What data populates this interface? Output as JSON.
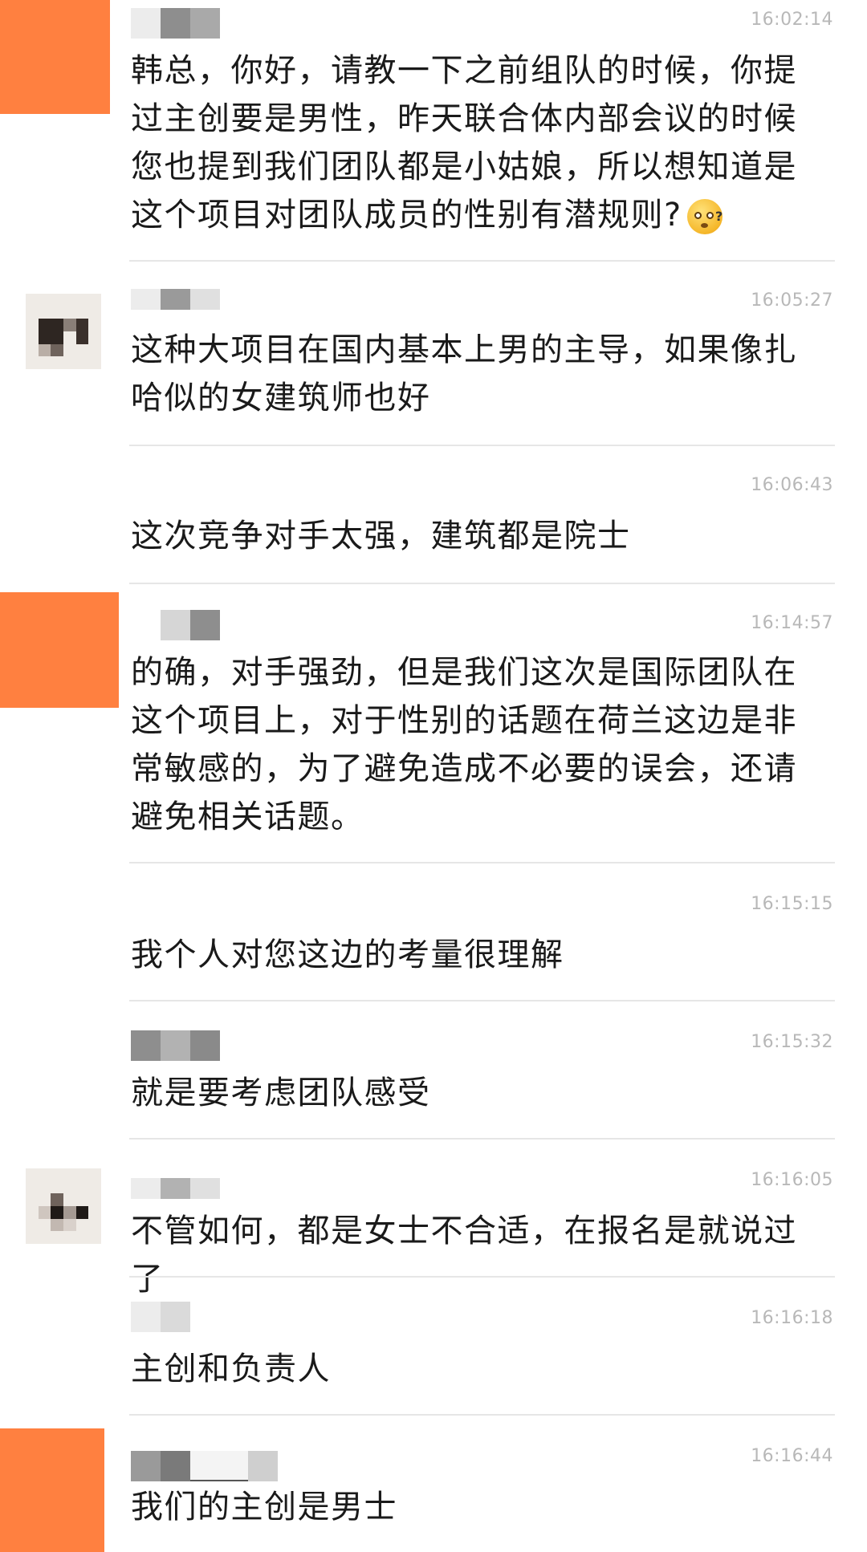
{
  "messages": [
    {
      "time": "16:02:14",
      "text": "韩总，你好，请教一下之前组队的时候，你提过主创要是男性，昨天联合体内部会议的时候您也提到我们团队都是小姑娘，所以想知道是这个项目对团队成员的性别有潜规则?",
      "emoji": "?"
    },
    {
      "time": "16:05:27",
      "text": "这种大项目在国内基本上男的主导，如果像扎哈似的女建筑师也好"
    },
    {
      "time": "16:06:43",
      "text": "这次竞争对手太强，建筑都是院士"
    },
    {
      "time": "16:14:57",
      "text": "的确，对手强劲，但是我们这次是国际团队在这个项目上，对于性别的话题在荷兰这边是非常敏感的，为了避免造成不必要的误会，还请避免相关话题。"
    },
    {
      "time": "16:15:15",
      "text": "我个人对您这边的考量很理解"
    },
    {
      "time": "16:15:32",
      "text": "就是要考虑团队感受"
    },
    {
      "time": "16:16:05",
      "text": "不管如何，都是女士不合适，在报名是就说过了"
    },
    {
      "time": "16:16:18",
      "text": "主创和负责人"
    },
    {
      "time": "16:16:44",
      "text": "我们的主创是男士"
    }
  ],
  "colors": {
    "avatar_orange": "#ff8040",
    "time_gray": "#b8b8b8",
    "separator": "#e6e6e6"
  }
}
